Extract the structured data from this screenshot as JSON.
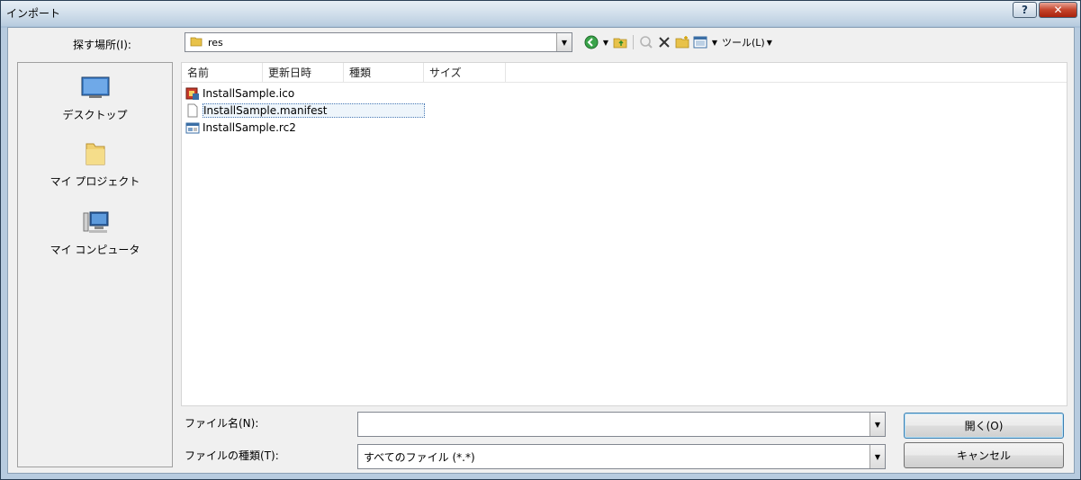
{
  "window": {
    "title": "インポート",
    "help_label": "?",
    "close_label": "✕"
  },
  "lookin": {
    "label": "探す場所(I):",
    "value": "res"
  },
  "toolbar": {
    "tools_label": "ツール(L)"
  },
  "places": [
    {
      "label": "デスクトップ",
      "icon": "desktop-icon"
    },
    {
      "label": "マイ プロジェクト",
      "icon": "folder-icon"
    },
    {
      "label": "マイ コンピュータ",
      "icon": "computer-icon"
    }
  ],
  "columns": [
    "名前",
    "更新日時",
    "種類",
    "サイズ"
  ],
  "files": [
    {
      "name": "InstallSample.ico",
      "icon": "ico-file-icon"
    },
    {
      "name": "InstallSample.manifest",
      "icon": "blank-file-icon"
    },
    {
      "name": "InstallSample.rc2",
      "icon": "rc-file-icon"
    }
  ],
  "filename": {
    "label": "ファイル名(N):",
    "value": ""
  },
  "filetype": {
    "label": "ファイルの種類(T):",
    "value": "すべてのファイル (*.*)"
  },
  "buttons": {
    "open": "開く(O)",
    "cancel": "キャンセル"
  },
  "colors": {
    "accent": "#3c7fb1",
    "close": "#c5442b",
    "folder": "#e8c24a"
  }
}
